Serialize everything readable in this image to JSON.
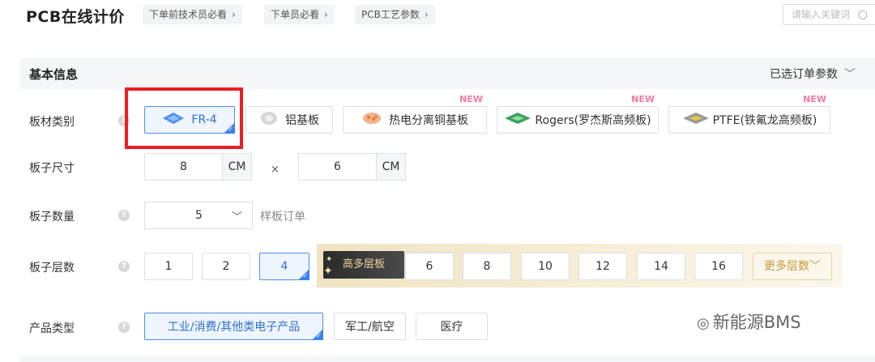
{
  "header": {
    "title": "PCB在线计价",
    "guides": [
      {
        "label": "下单前技术员必看"
      },
      {
        "label": "下单员必看"
      },
      {
        "label": "PCB工艺参数"
      }
    ],
    "search": {
      "placeholder": "请输入关键词"
    }
  },
  "section": {
    "title": "基本信息",
    "right_label": "已选订单参数"
  },
  "material": {
    "label": "板材类别",
    "options": [
      {
        "label": "FR-4",
        "selected": true,
        "icon": "fr4-icon"
      },
      {
        "label": "铝基板",
        "selected": false,
        "icon": "aluminum-icon"
      },
      {
        "label": "热电分离铜基板",
        "selected": false,
        "icon": "copper-icon",
        "tag": "NEW"
      },
      {
        "label": "Rogers(罗杰斯高频板)",
        "selected": false,
        "icon": "rogers-icon",
        "tag": "NEW"
      },
      {
        "label": "PTFE(铁氟龙高频板)",
        "selected": false,
        "icon": "ptfe-icon",
        "tag": "NEW"
      }
    ]
  },
  "size": {
    "label": "板子尺寸",
    "width": "8",
    "height": "6",
    "unit": "CM",
    "separator": "×"
  },
  "quantity": {
    "label": "板子数量",
    "value": "5",
    "note": "样板订单"
  },
  "layers": {
    "label": "板子层数",
    "options": [
      "1",
      "2",
      "4"
    ],
    "selected": "4",
    "premium_badge": "高多层板",
    "premium_options": [
      "6",
      "8",
      "10",
      "12",
      "14",
      "16"
    ],
    "more_label": "更多层数"
  },
  "product": {
    "label": "产品类型",
    "options": [
      {
        "label": "工业/消费/其他类电子产品",
        "selected": true
      },
      {
        "label": "军工/航空",
        "selected": false
      },
      {
        "label": "医疗",
        "selected": false
      }
    ]
  },
  "watermark": {
    "text": "新能源BMS"
  },
  "colors": {
    "accent": "#3b82f0",
    "highlight": "#ee1c25",
    "new_tag": "#f07aa0",
    "gold": "#c39a3c"
  }
}
